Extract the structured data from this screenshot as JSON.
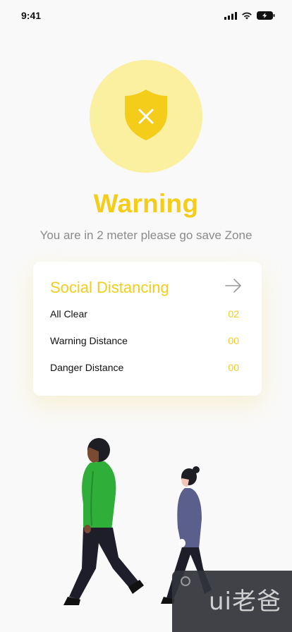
{
  "status_bar": {
    "time": "9:41"
  },
  "hero": {
    "title": "Warning",
    "subtitle": "You are in 2 meter please go save Zone"
  },
  "card": {
    "title": "Social Distancing",
    "rows": [
      {
        "label": "All Clear",
        "value": "02"
      },
      {
        "label": "Warning Distance",
        "value": "00"
      },
      {
        "label": "Danger Distance",
        "value": "00"
      }
    ]
  },
  "watermark": {
    "text": "ui老爸"
  },
  "colors": {
    "accent": "#f4cd1b",
    "circle": "#fbf0a0",
    "background": "#f9f9f9"
  }
}
